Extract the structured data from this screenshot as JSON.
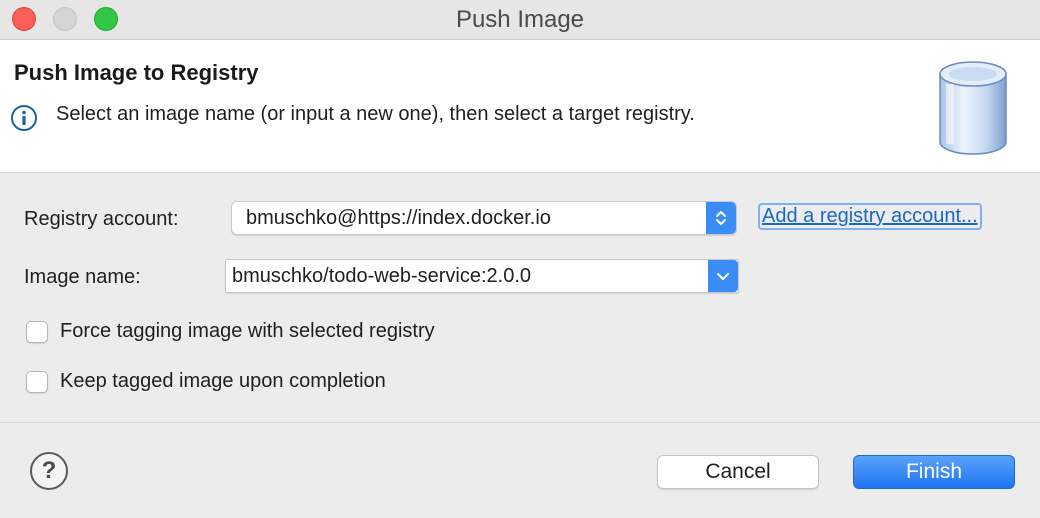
{
  "window": {
    "title": "Push Image"
  },
  "header": {
    "title": "Push Image to Registry",
    "description": "Select an image name (or input a new one), then select a target registry.",
    "info_icon": "info-icon",
    "banner_icon": "database-icon"
  },
  "form": {
    "registry_account": {
      "label": "Registry account:",
      "value": "bmuschko@https://index.docker.io",
      "add_link": "Add a registry account..."
    },
    "image_name": {
      "label": "Image name:",
      "value": "bmuschko/todo-web-service:2.0.0"
    },
    "force_tagging": {
      "label": "Force tagging image with selected registry",
      "checked": false
    },
    "keep_tagged": {
      "label": "Keep tagged image upon completion",
      "checked": false
    }
  },
  "footer": {
    "help_icon": "question-icon",
    "help_glyph": "?",
    "cancel_label": "Cancel",
    "finish_label": "Finish"
  },
  "colors": {
    "accent": "#3a8cf6",
    "link": "#1a67c9",
    "close": "#fc5f57",
    "maximize": "#33c748"
  }
}
